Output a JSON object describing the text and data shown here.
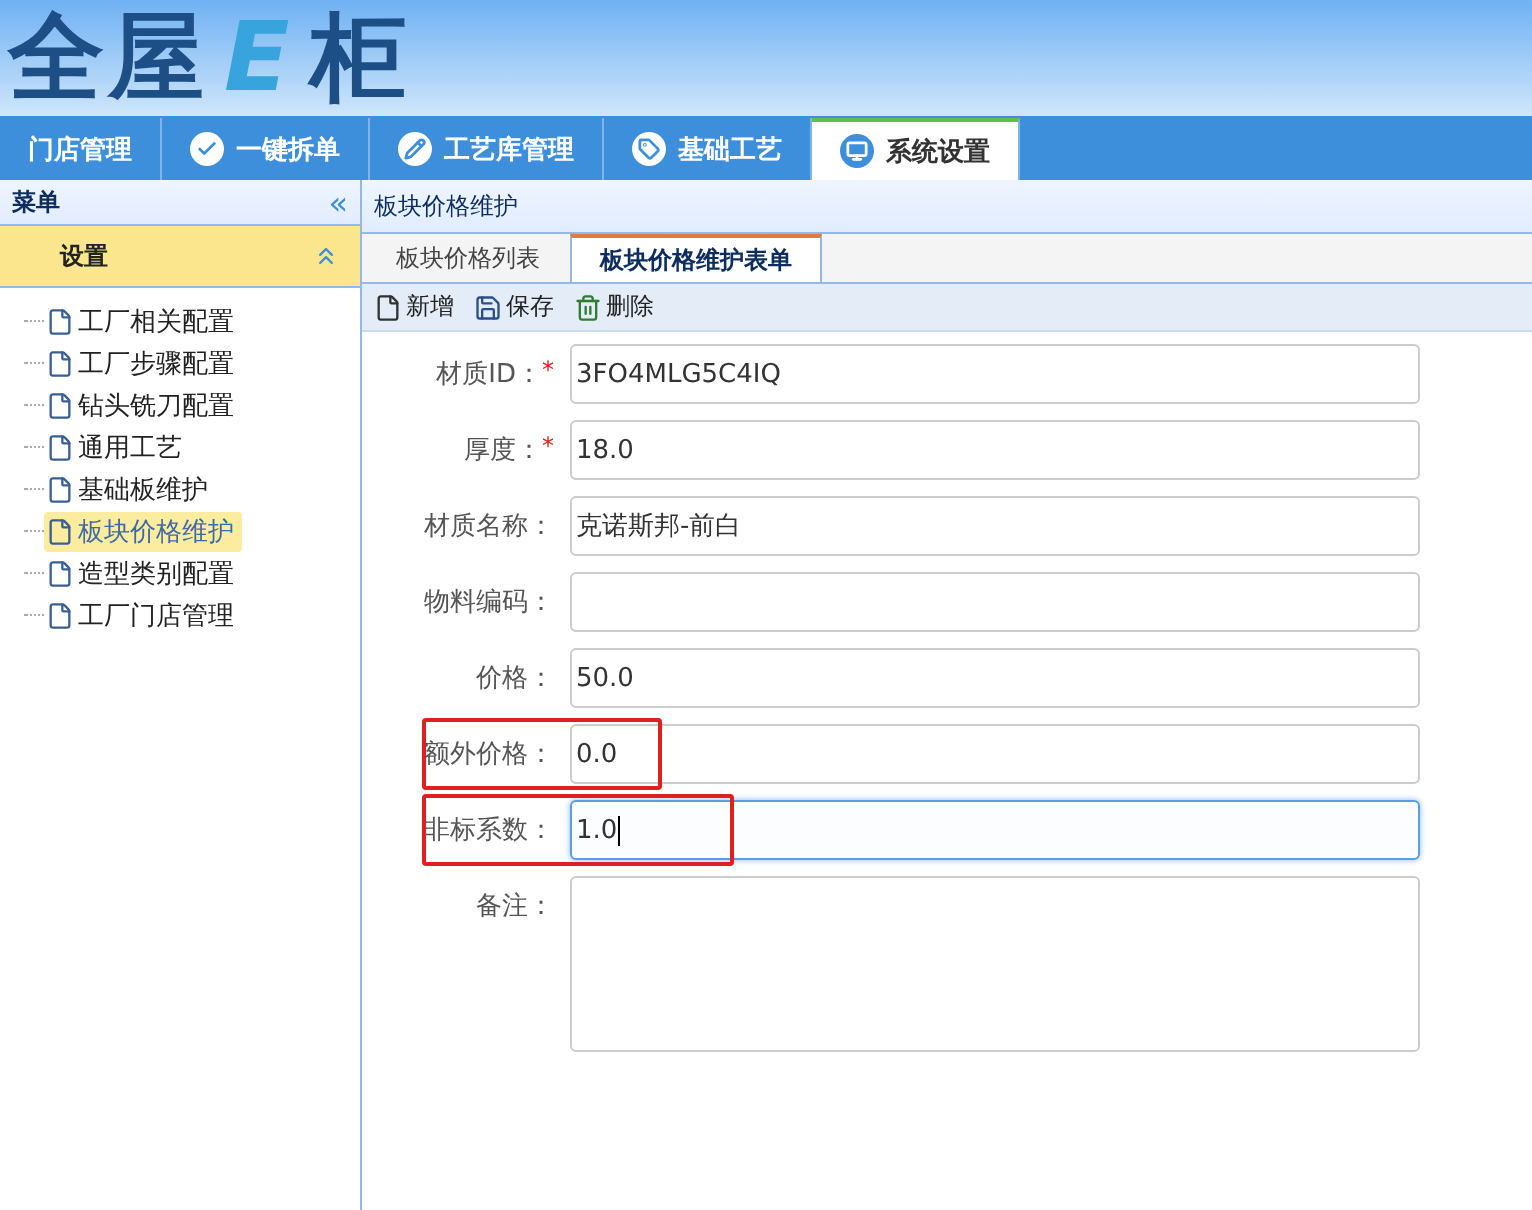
{
  "logo": [
    {
      "text": "全屋",
      "accent": false
    },
    {
      "text": "E",
      "accent": true
    },
    {
      "text": "柜",
      "accent": false
    }
  ],
  "nav": [
    {
      "label": "门店管理",
      "selected": false
    },
    {
      "label": "一键拆单",
      "selected": false
    },
    {
      "label": "工艺库管理",
      "selected": false
    },
    {
      "label": "基础工艺",
      "selected": false
    },
    {
      "label": "系统设置",
      "selected": true
    }
  ],
  "sidebar": {
    "title": "菜单",
    "collapse": "«",
    "section": {
      "label": "设置",
      "expanded": true
    },
    "items": [
      {
        "label": "工厂相关配置",
        "selected": false
      },
      {
        "label": "工厂步骤配置",
        "selected": false
      },
      {
        "label": "钻头铣刀配置",
        "selected": false
      },
      {
        "label": "通用工艺",
        "selected": false
      },
      {
        "label": "基础板维护",
        "selected": false
      },
      {
        "label": "板块价格维护",
        "selected": true
      },
      {
        "label": "造型类别配置",
        "selected": false
      },
      {
        "label": "工厂门店管理",
        "selected": false
      }
    ]
  },
  "panel_title": "板块价格维护",
  "tabs": [
    {
      "label": "板块价格列表",
      "selected": false
    },
    {
      "label": "板块价格维护表单",
      "selected": true
    }
  ],
  "toolbar": [
    {
      "label": "新增",
      "kind": "new"
    },
    {
      "label": "保存",
      "kind": "save"
    },
    {
      "label": "删除",
      "kind": "delete"
    }
  ],
  "form": [
    {
      "label": "材质ID：",
      "required_mark": "*",
      "value": "3FO4MLG5C4IQ",
      "kind": "input",
      "highlighted": false
    },
    {
      "label": "厚度：",
      "required_mark": "*",
      "value": "18.0",
      "kind": "input",
      "highlighted": false
    },
    {
      "label": "材质名称：",
      "value": "克诺斯邦-前白",
      "kind": "input",
      "highlighted": false
    },
    {
      "label": "物料编码：",
      "kind": "input",
      "highlighted": false
    },
    {
      "label": "价格：",
      "value": "50.0",
      "kind": "input",
      "highlighted": false
    },
    {
      "label": "额外价格：",
      "value": "0.0",
      "kind": "input",
      "highlighted": true
    },
    {
      "label": "非标系数：",
      "value": "1.0",
      "kind": "input",
      "highlighted": true,
      "focused": true
    },
    {
      "label": "备注：",
      "kind": "textarea",
      "highlighted": false
    }
  ]
}
